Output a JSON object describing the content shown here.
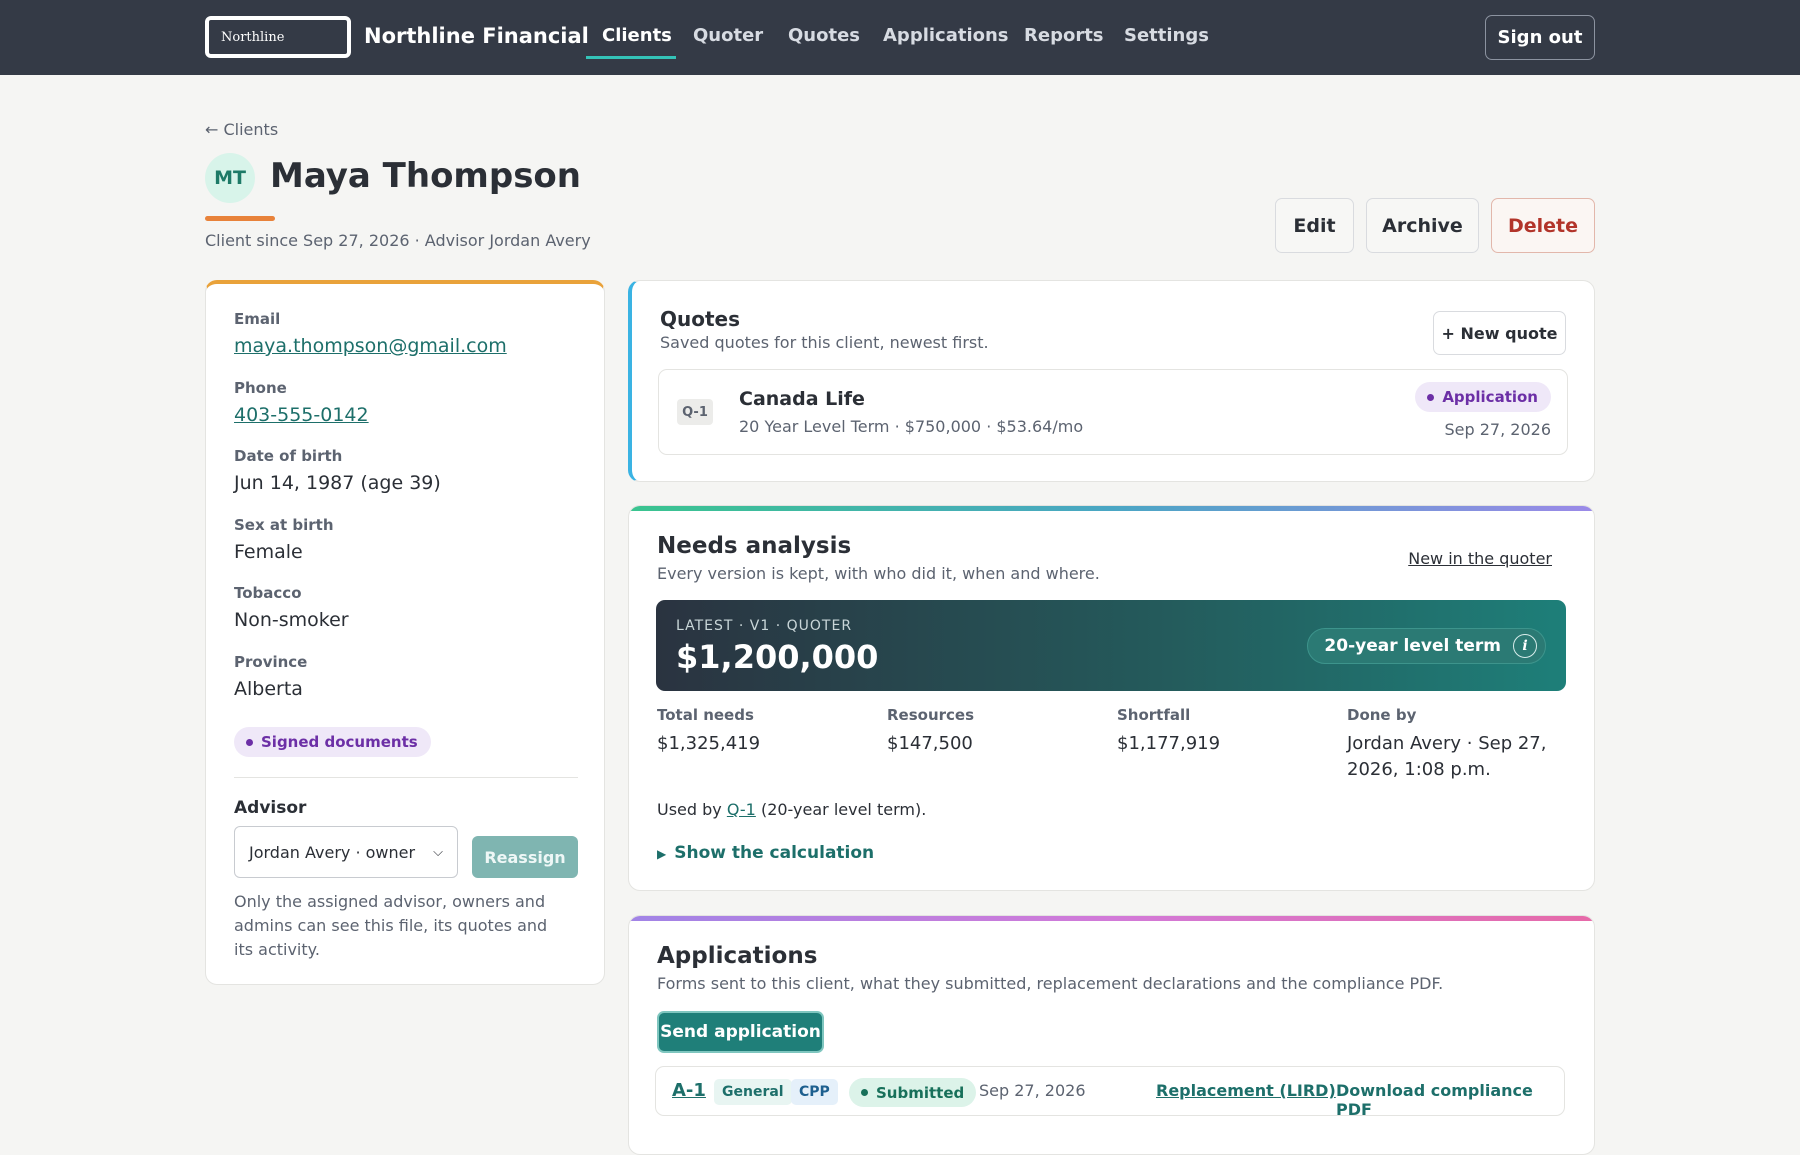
{
  "nav": {
    "logo_text": "Northline",
    "brand": "Northline Financial",
    "items": [
      {
        "label": "Clients",
        "active": true
      },
      {
        "label": "Quoter"
      },
      {
        "label": "Quotes"
      },
      {
        "label": "Applications"
      },
      {
        "label": "Reports"
      },
      {
        "label": "Settings"
      }
    ],
    "signout_label": "Sign out"
  },
  "header": {
    "back_label": "← Clients",
    "initials": "MT",
    "name": "Maya Thompson",
    "subline": "Client since Sep 27, 2026 · Advisor Jordan Avery",
    "edit_label": "Edit",
    "archive_label": "Archive",
    "delete_label": "Delete"
  },
  "profile": {
    "email_label": "Email",
    "email": "maya.thompson@gmail.com",
    "phone_label": "Phone",
    "phone": "403-555-0142",
    "dob_label": "Date of birth",
    "dob": "Jun 14, 1987 (age 39)",
    "sex_label": "Sex at birth",
    "sex": "Female",
    "tobacco_label": "Tobacco",
    "tobacco": "Non-smoker",
    "province_label": "Province",
    "province": "Alberta",
    "signed_badge": "Signed documents",
    "advisor_label": "Advisor",
    "advisor_selected": "Jordan Avery · owner",
    "reassign_label": "Reassign",
    "advisor_note": "Only the assigned advisor, owners and admins can see this file, its quotes and its activity."
  },
  "quotes": {
    "title": "Quotes",
    "subtitle": "Saved quotes for this client, newest first.",
    "new_label": "+ New quote",
    "items": [
      {
        "id": "Q-1",
        "carrier": "Canada Life",
        "detail": "20 Year Level Term · $750,000 · $53.64/mo",
        "status": "Application",
        "date": "Sep 27, 2026"
      }
    ]
  },
  "needs": {
    "title": "Needs analysis",
    "subtitle": "Every version is kept, with who did it, when and where.",
    "new_link": "New in the quoter",
    "hero_label": "LATEST · V1 · QUOTER",
    "hero_amount": "$1,200,000",
    "hero_pill": "20-year level term",
    "stats": [
      {
        "label": "Total needs",
        "value": "$1,325,419"
      },
      {
        "label": "Resources",
        "value": "$147,500"
      },
      {
        "label": "Shortfall",
        "value": "$1,177,919"
      },
      {
        "label": "Done by",
        "value": "Jordan Avery · Sep 27, 2026, 1:08 p.m."
      }
    ],
    "used_by_prefix": "Used by",
    "used_by_link": "Q-1",
    "used_by_suffix": "(20-year level term).",
    "show_calc": "Show the calculation"
  },
  "applications": {
    "title": "Applications",
    "subtitle": "Forms sent to this client, what they submitted, replacement declarations and the compliance PDF.",
    "send_label": "Send application",
    "items": [
      {
        "id": "A-1",
        "tag1": "General",
        "tag2": "CPP",
        "status": "Submitted",
        "date": "Sep 27, 2026",
        "replacement_link": "Replacement (LIRD)",
        "pdf_link": "Download compliance PDF"
      }
    ]
  },
  "colors": {
    "nav_bg": "#343a46",
    "accent_teal": "#1f7f79",
    "delete_red": "#b2342a",
    "status_purple": "#6c2fa6"
  }
}
